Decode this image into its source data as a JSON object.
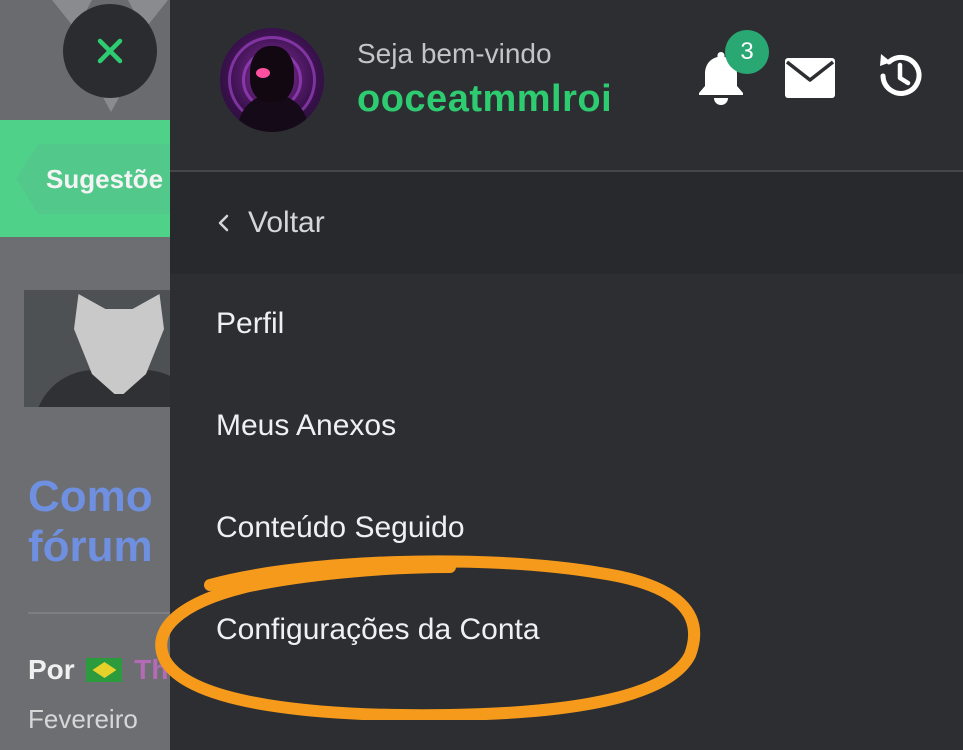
{
  "background": {
    "banner_label": "Sugestõe",
    "title_lines": [
      "Como",
      "fórum"
    ],
    "author_prefix": "Por",
    "author_name": "Th",
    "date": "Fevereiro"
  },
  "drawer": {
    "welcome_text": "Seja bem-vindo",
    "username": "ooceatmmlroi",
    "notification_count": "3",
    "back_label": "Voltar",
    "menu": [
      {
        "label": "Perfil"
      },
      {
        "label": "Meus Anexos"
      },
      {
        "label": "Conteúdo Seguido"
      },
      {
        "label": "Configurações da Conta"
      }
    ]
  },
  "icons": {
    "close": "close-icon",
    "bell": "bell-icon",
    "mail": "mail-icon",
    "history": "history-icon",
    "back": "chevron-left-icon"
  },
  "colors": {
    "drawer_bg": "#2d2e32",
    "username": "#2ecc71",
    "badge": "#2aa874",
    "close_x": "#2ecc71",
    "banner": "#4fd18a",
    "highlight": "#f59a1b"
  }
}
